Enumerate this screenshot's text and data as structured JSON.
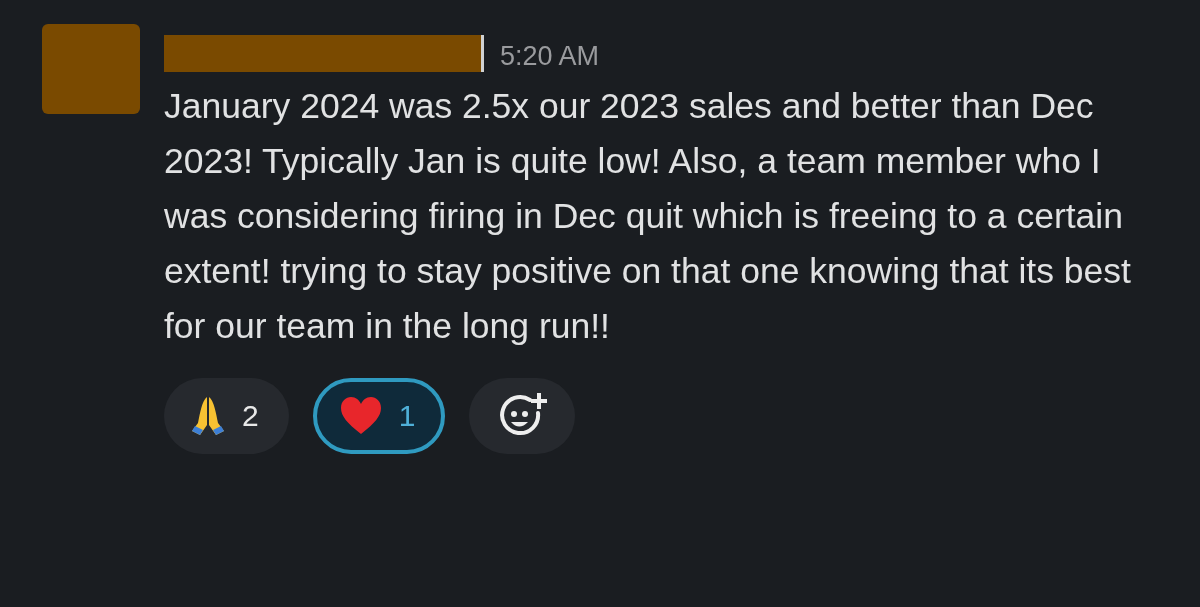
{
  "message": {
    "time": "5:20 AM",
    "text": "January 2024 was 2.5x our 2023 sales and better than Dec 2023! Typically Jan is quite low! Also, a team member who I was considering firing in Dec quit which is freeing to a certain extent! trying to stay positive on that one knowing that its best for our team in the long run!!",
    "reactions": [
      {
        "kind": "pray",
        "count": "2",
        "selected": false
      },
      {
        "kind": "heart",
        "count": "1",
        "selected": true
      }
    ]
  }
}
